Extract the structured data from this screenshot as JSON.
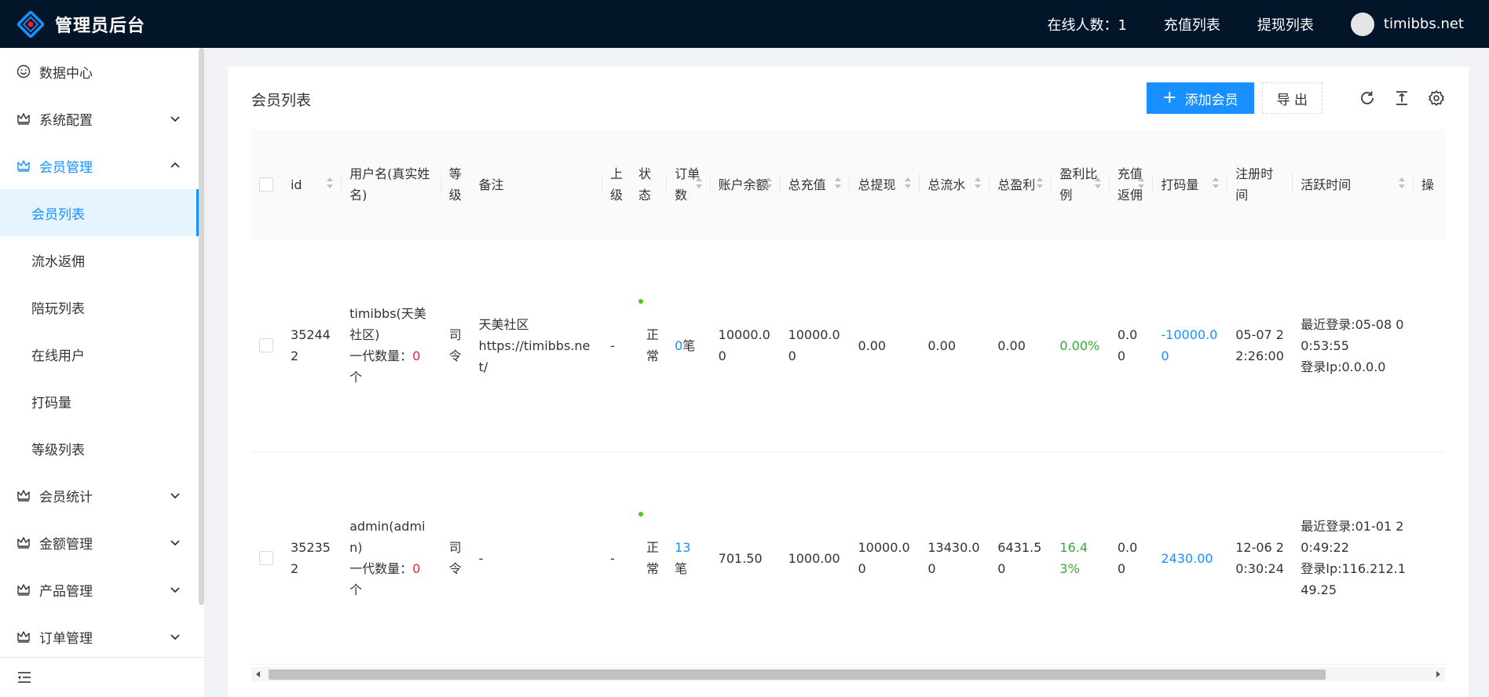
{
  "header": {
    "title": "管理员后台",
    "online_label": "在线人数：1",
    "recharge_link": "充值列表",
    "withdraw_link": "提现列表",
    "username": "timibbs.net"
  },
  "sidebar": {
    "items": [
      {
        "label": "数据中心",
        "icon": "smile-icon"
      },
      {
        "label": "系统配置",
        "icon": "crown-icon",
        "expandable": true
      },
      {
        "label": "会员管理",
        "icon": "crown-icon",
        "expanded": true
      },
      {
        "label": "会员统计",
        "icon": "crown-icon",
        "expandable": true
      },
      {
        "label": "金额管理",
        "icon": "crown-icon",
        "expandable": true
      },
      {
        "label": "产品管理",
        "icon": "crown-icon",
        "expandable": true
      },
      {
        "label": "订单管理",
        "icon": "crown-icon",
        "expandable": true
      }
    ],
    "sub_items": [
      "会员列表",
      "流水返佣",
      "陪玩列表",
      "在线用户",
      "打码量",
      "等级列表"
    ],
    "active_sub": "会员列表"
  },
  "main": {
    "title": "会员列表",
    "add_button": "添加会员",
    "export_button": "导 出"
  },
  "table": {
    "headers": {
      "id": "id",
      "username": "用户名(真实姓名)",
      "level": "等级",
      "remark": "备注",
      "parent": "上级",
      "status": "状态",
      "orders": "订单数",
      "balance": "账户余额",
      "total_recharge": "总充值",
      "total_withdraw": "总提现",
      "total_flow": "总流水",
      "total_profit": "总盈利",
      "profit_ratio": "盈利比例",
      "recharge_rebate": "充值返佣",
      "bet_volume": "打码量",
      "reg_time": "注册时间",
      "active_time": "活跃时间",
      "cut_off": "操"
    },
    "rows": [
      {
        "id": "352442",
        "username": "timibbs(天美社区)",
        "gen_label": "一代数量：",
        "gen_count": "0",
        "gen_unit": "个",
        "level": "司令",
        "remark_line1": "天美社区",
        "remark_line2": "https://timibbs.net/",
        "parent": "-",
        "status": "正常",
        "orders_count": "0",
        "orders_unit": "笔",
        "balance": "10000.00",
        "total_recharge": "10000.00",
        "total_withdraw": "0.00",
        "total_flow": "0.00",
        "total_profit": "0.00",
        "profit_ratio": "0.00%",
        "recharge_rebate": "0.00",
        "bet_volume": "-10000.00",
        "reg_time": "05-07 22:26:00",
        "last_login": "最近登录:05-08 00:53:55",
        "login_ip": "登录Ip:0.0.0.0"
      },
      {
        "id": "352352",
        "username": "admin(admin)",
        "gen_label": "一代数量：",
        "gen_count": "0",
        "gen_unit": "个",
        "level": "司令",
        "remark_line1": "-",
        "remark_line2": "",
        "parent": "-",
        "status": "正常",
        "orders_count": "13",
        "orders_unit": "笔",
        "balance": "701.50",
        "total_recharge": "1000.00",
        "total_withdraw": "10000.00",
        "total_flow": "13430.00",
        "total_profit": "6431.50",
        "profit_ratio": "16.43%",
        "recharge_rebate": "0.00",
        "bet_volume": "2430.00",
        "reg_time": "12-06 20:30:24",
        "last_login": "最近登录:01-01 20:49:22",
        "login_ip": "登录Ip:116.212.149.25"
      }
    ]
  },
  "colors": {
    "topbar": "#021529",
    "accent": "#1890ff",
    "negative": "#f5222d",
    "positive": "#52c41a"
  }
}
